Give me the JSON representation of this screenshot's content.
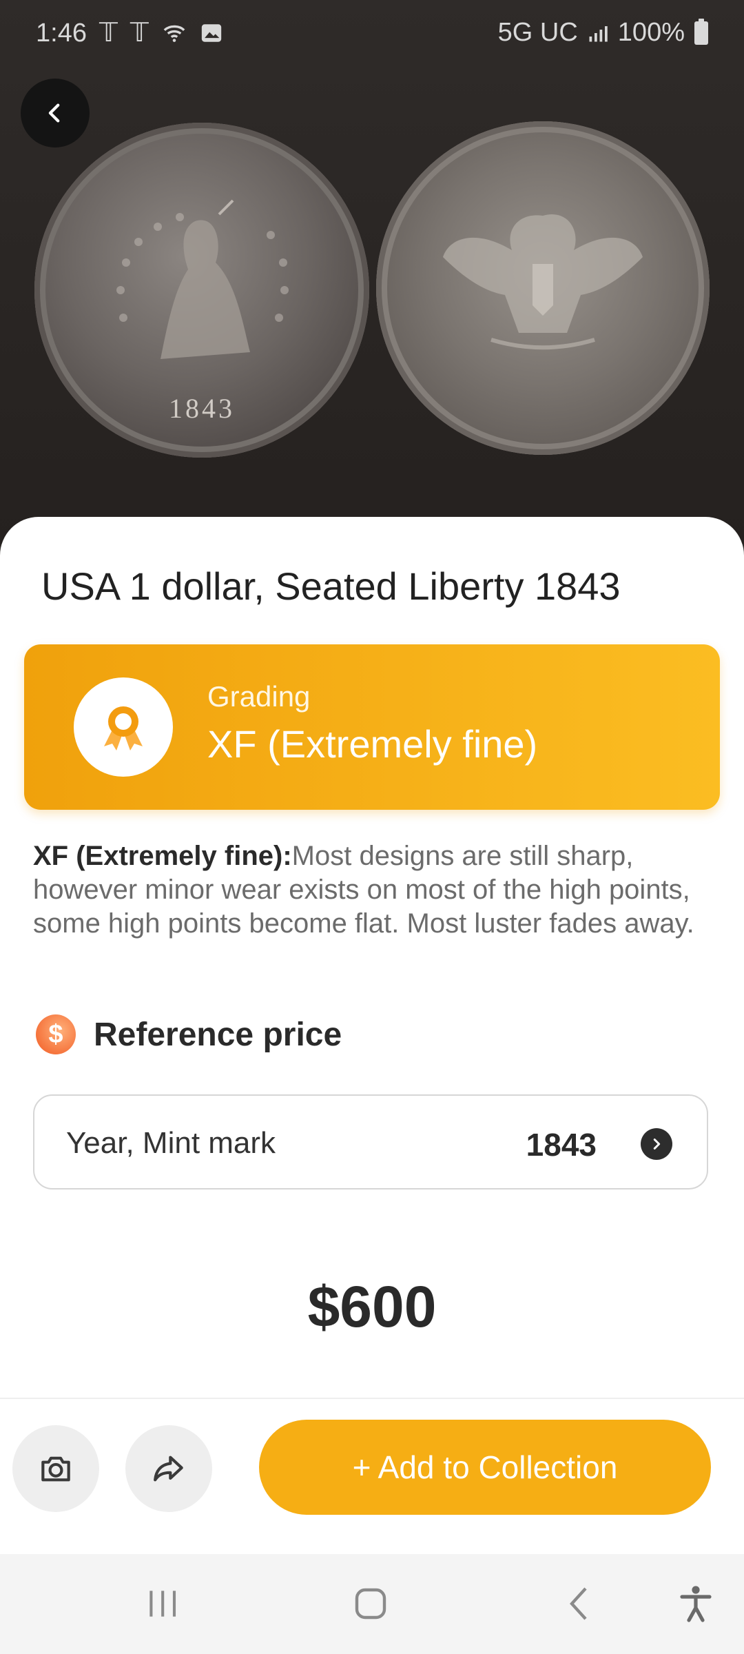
{
  "status_bar": {
    "time": "1:46",
    "network": "5G UC",
    "battery": "100%",
    "left_icons": [
      "tmobile-icon",
      "tmobile-icon",
      "wifi-icon",
      "image-icon"
    ]
  },
  "hero": {
    "coin_date": "1843",
    "back_icon": "chevron-left-icon"
  },
  "detail": {
    "title": "USA 1 dollar, Seated Liberty 1843",
    "grading": {
      "label": "Grading",
      "value": "XF (Extremely fine)",
      "icon": "award-ribbon-icon"
    },
    "grade_description": {
      "term": "XF (Extremely fine):",
      "text": "Most designs are still sharp, however minor wear exists on most of the high points, some high points become flat. Most luster fades away."
    },
    "reference_price": {
      "title": "Reference price",
      "icon": "dollar-coin-icon",
      "selector_label": "Year, Mint mark",
      "selector_value": "1843",
      "price": "$600"
    }
  },
  "actions": {
    "add_label": "+ Add to Collection",
    "camera_icon": "camera-icon",
    "share_icon": "share-icon"
  },
  "colors": {
    "accent": "#f6ae14",
    "grading_gradient_start": "#f0a10c",
    "grading_gradient_end": "#fbbd22",
    "dollar_icon": "#f15a22"
  },
  "nav_bar": {
    "icons": [
      "recent-apps-icon",
      "home-icon",
      "back-icon",
      "accessibility-icon"
    ]
  }
}
